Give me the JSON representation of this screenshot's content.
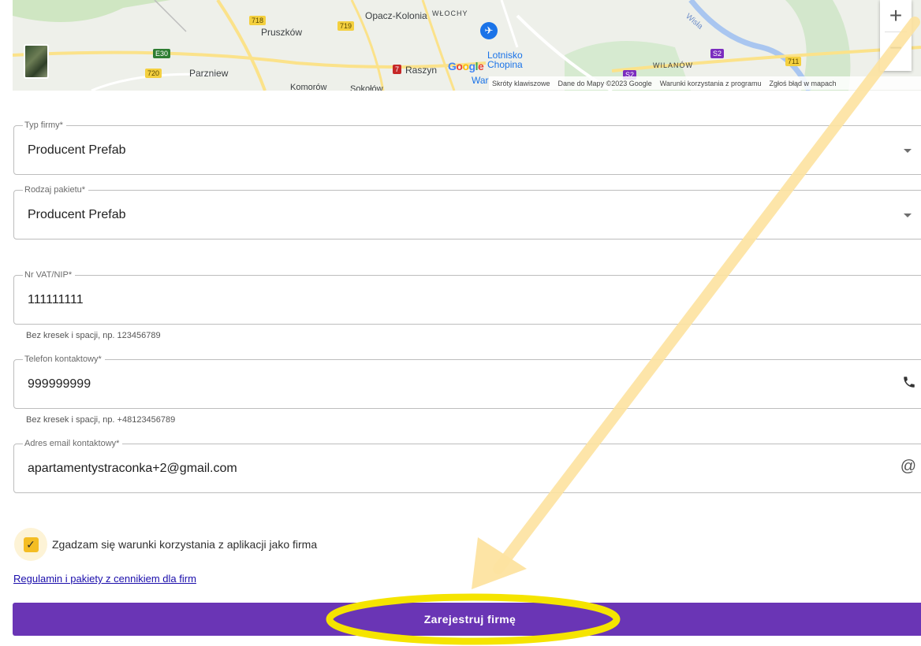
{
  "map": {
    "labels": {
      "opacz": "Opacz-Kolonia",
      "wlochy": "WŁOCHY",
      "pruszkow": "Pruszków",
      "parzniew": "Parzniew",
      "raszyn": "Raszyn",
      "komorow": "Komorów",
      "sokolow": "Sokołów",
      "wilanow": "WILANÓW",
      "wisla": "Wisła",
      "airport": "Lotnisko Chopina",
      "war": "War"
    },
    "shields": {
      "r718": "718",
      "r719": "719",
      "e30": "E30",
      "r720": "720",
      "r7": "7",
      "s2a": "S2",
      "s2b": "S2",
      "r711": "711"
    },
    "google_logo": [
      "G",
      "o",
      "o",
      "g",
      "l",
      "e"
    ],
    "attribution": {
      "shortcuts": "Skróty klawiszowe",
      "data": "Dane do Mapy ©2023 Google",
      "terms": "Warunki korzystania z programu",
      "report": "Zgłoś błąd w mapach"
    },
    "zoom_in": "+",
    "zoom_out": "−"
  },
  "form": {
    "company_type": {
      "label": "Typ firmy*",
      "value": "Producent Prefab"
    },
    "package_type": {
      "label": "Rodzaj pakietu*",
      "value": "Producent Prefab"
    },
    "vat": {
      "label": "Nr VAT/NIP*",
      "value": "111111111",
      "helper": "Bez kresek i spacji, np. 123456789"
    },
    "phone": {
      "label": "Telefon kontaktowy*",
      "value": "999999999",
      "helper": "Bez kresek i spacji, np. +48123456789"
    },
    "email": {
      "label": "Adres email kontaktowy*",
      "value": "apartamentystraconka+2@gmail.com"
    },
    "consent_label": "Zgadzam się warunki korzystania z aplikacji jako firma",
    "consent_checked": true,
    "terms_link": "Regulamin i pakiety z cennikiem dla firm",
    "submit_label": "Zarejestruj firmę"
  },
  "colors": {
    "accent": "#6a35b5",
    "checkbox": "#f4bd24",
    "annotation_arrow": "#fde3a0",
    "annotation_ellipse": "#f5e400"
  },
  "icons": {
    "phone": "phone-icon",
    "at": "at-sign-icon",
    "check": "check-icon",
    "dropdown": "chevron-down-icon"
  }
}
